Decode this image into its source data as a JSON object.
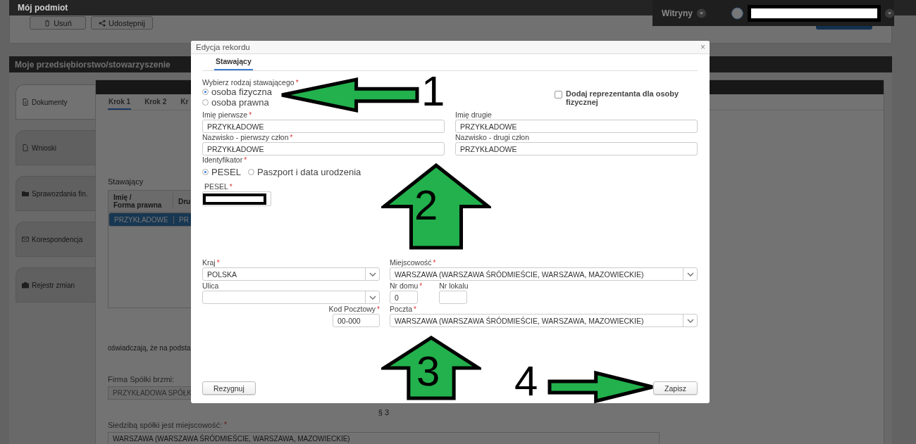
{
  "topbar": {
    "title": "Mój podmiot",
    "sites_label": "Witryny"
  },
  "toolbar": {
    "buttons": [
      {
        "label": "Usuń",
        "kind": "trash"
      },
      {
        "label": "Udostępnij",
        "kind": "share"
      }
    ]
  },
  "section": {
    "title": "Moje przedsiębiorstwo/stowarzyszenie"
  },
  "side_tabs": [
    {
      "label": "Dokumenty",
      "kind": "document",
      "selected": true
    },
    {
      "label": "Wnioski",
      "kind": "file",
      "selected": false
    },
    {
      "label": "Sprawozdania fin.",
      "kind": "folder",
      "selected": false
    },
    {
      "label": "Korespondencja",
      "kind": "envelope",
      "selected": false
    },
    {
      "label": "Rejestr zmian",
      "kind": "briefcase",
      "selected": false
    }
  ],
  "steps": [
    {
      "label": "Krok 1",
      "selected": true
    },
    {
      "label": "Krok 2",
      "selected": false
    },
    {
      "label": "Kr",
      "selected": false
    }
  ],
  "parties": {
    "label": "Stawający",
    "columns": [
      "Imię /\nForma prawna",
      "Dru"
    ],
    "rows": [
      {
        "cells": [
          "PRZYKŁADOWE",
          "PR"
        ],
        "selected": true
      }
    ]
  },
  "declaration": "oświadczają, że na podsta",
  "company": {
    "label": "Firma Spółki brzmi:",
    "value": "PRZYKŁADOWA SPÓŁK"
  },
  "paragraph": "§ 3",
  "seat": {
    "label": "Siedzibą spółki jest miejscowość:",
    "mark": "*",
    "value": "WARSZAWA (WARSZAWA ŚRÓDMIEŚCIE, WARSZAWA, MAZOWIECKIE)"
  },
  "dialog": {
    "title": "Edycja rekordu",
    "close": "×",
    "tabs": [
      {
        "label": "Stawający",
        "selected": true
      }
    ],
    "party_type": {
      "label": "Wybierz rodzaj stawającego",
      "mark": "*",
      "options": [
        {
          "label": "osoba fizyczna",
          "selected": true
        },
        {
          "label": "osoba prawna",
          "selected": false
        }
      ]
    },
    "representative": {
      "label": "Dodaj reprezentanta dla osoby fizycznej",
      "checked": false
    },
    "names": [
      {
        "label": "Imię pierwsze",
        "mark": "*",
        "value": "PRZYKŁADOWE"
      },
      {
        "label": "Imię drugie",
        "value": "PRZYKŁADOWE"
      },
      {
        "label": "Nazwisko - pierwszy człon",
        "mark": "*",
        "value": "PRZYKŁADOWE"
      },
      {
        "label": "Nazwisko - drugi człon",
        "value": "PRZYKŁADOWE"
      }
    ],
    "identifier": {
      "label": "Identyfikator",
      "mark": "*",
      "options": [
        {
          "label": "PESEL",
          "selected": true
        },
        {
          "label": "Paszport i data urodzenia",
          "selected": false
        }
      ]
    },
    "pesel": {
      "label": "PESEL",
      "mark": "*"
    },
    "country": {
      "label": "Kraj",
      "mark": "*",
      "value": "POLSKA"
    },
    "city": {
      "label": "Miejscowość",
      "mark": "*",
      "value": "WARSZAWA (WARSZAWA ŚRÓDMIEŚCIE, WARSZAWA, MAZOWIECKIE)"
    },
    "street": {
      "label": "Ulica"
    },
    "house_no": {
      "label": "Nr domu",
      "mark": "*",
      "value": "0"
    },
    "flat_no": {
      "label": "Nr lokalu"
    },
    "postal_code": {
      "label": "Kod Pocztowy",
      "mark": "*",
      "value": "00-000"
    },
    "post_office": {
      "label": "Poczta",
      "mark": "*",
      "value": "WARSZAWA (WARSZAWA ŚRÓDMIEŚCIE, WARSZAWA, MAZOWIECKIE)"
    },
    "buttons": [
      {
        "label": "Rezygnuj"
      },
      {
        "label": "Zapisz"
      }
    ]
  },
  "annotations": [
    {
      "number": "1",
      "kind": "left"
    },
    {
      "number": "2",
      "kind": "up"
    },
    {
      "number": "3",
      "kind": "up"
    },
    {
      "number": "4",
      "kind": "right"
    }
  ]
}
